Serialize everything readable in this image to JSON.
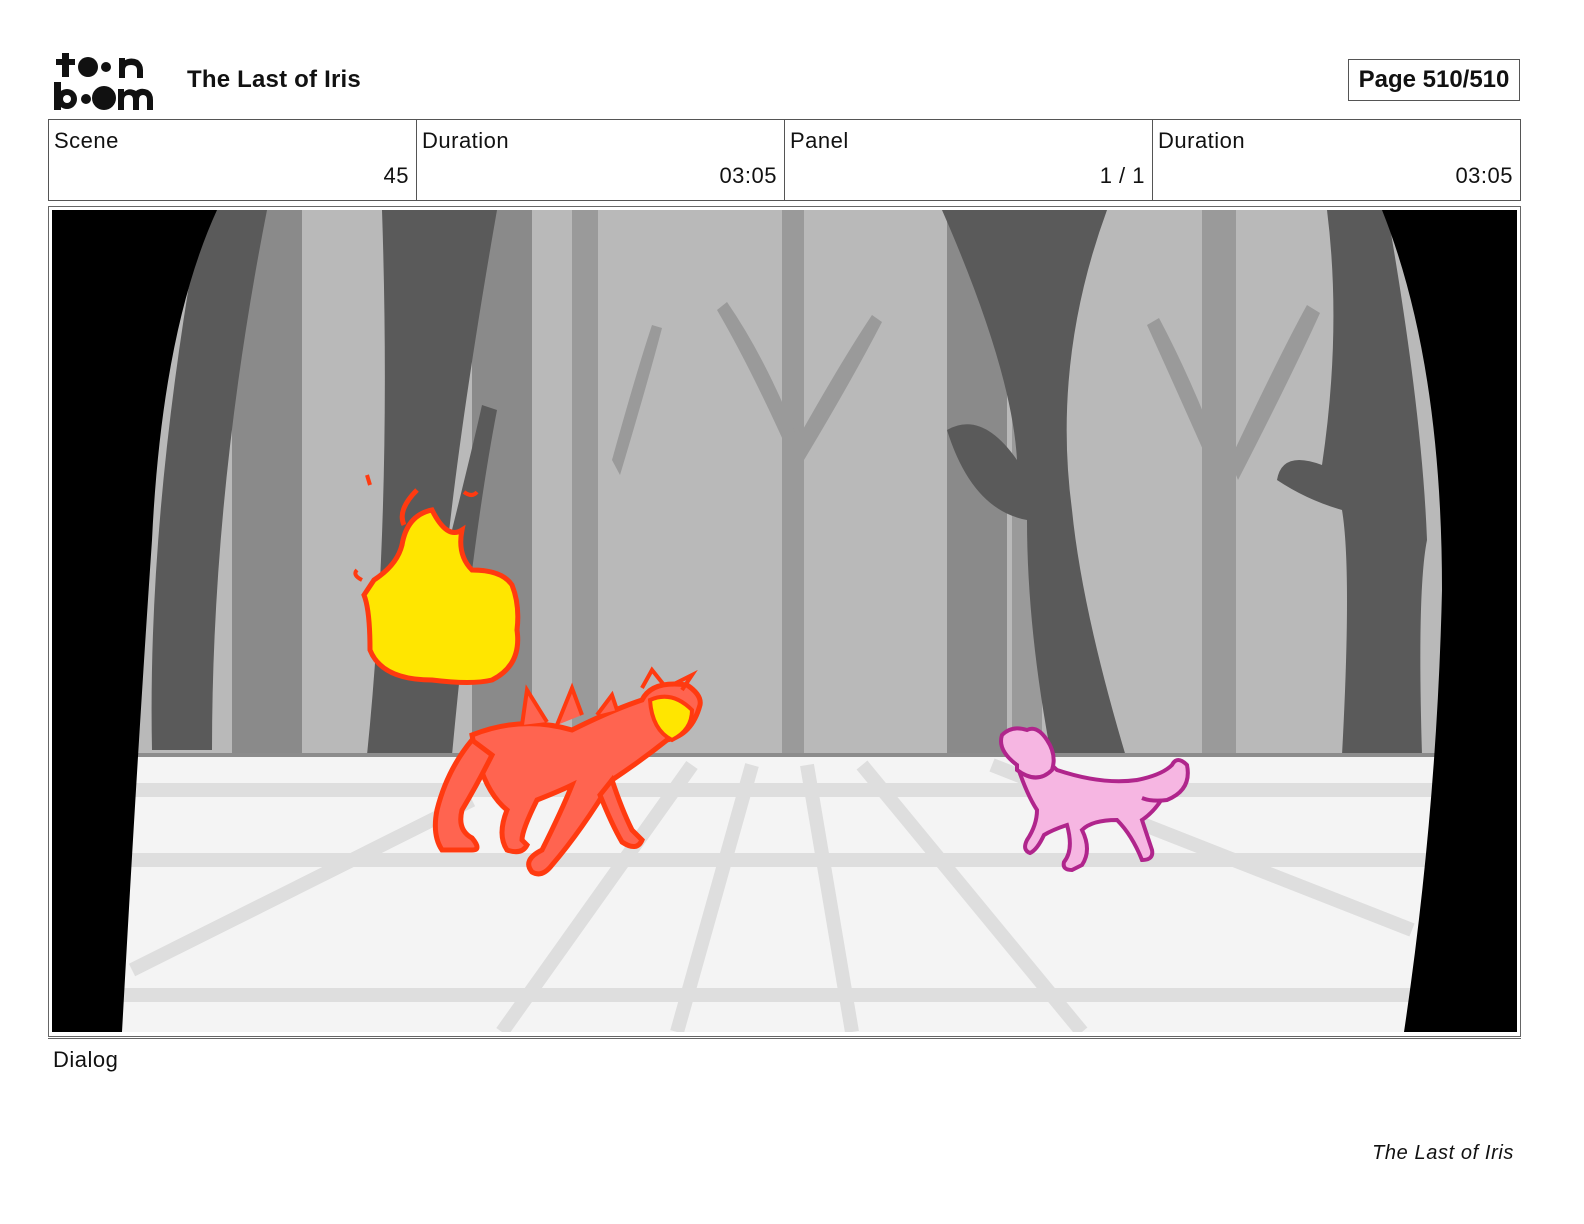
{
  "header": {
    "logo_text": "toonboom",
    "title": "The Last of Iris",
    "page_label": "Page 510/510"
  },
  "info": [
    {
      "label": "Scene",
      "value": "45"
    },
    {
      "label": "Duration",
      "value": "03:05"
    },
    {
      "label": "Panel",
      "value": "1 / 1"
    },
    {
      "label": "Duration",
      "value": "03:05"
    }
  ],
  "dialog": {
    "label": "Dialog"
  },
  "footer": {
    "title": "The Last of Iris"
  },
  "colors": {
    "fire_yellow": "#ffe600",
    "fire_outline": "#ff3a10",
    "red_wolf": "#ff6450",
    "pink_wolf": "#f6b6e2",
    "pink_outline": "#b0258c",
    "forest_bg": "#b9b9b9",
    "ground": "#f4f4f4"
  }
}
